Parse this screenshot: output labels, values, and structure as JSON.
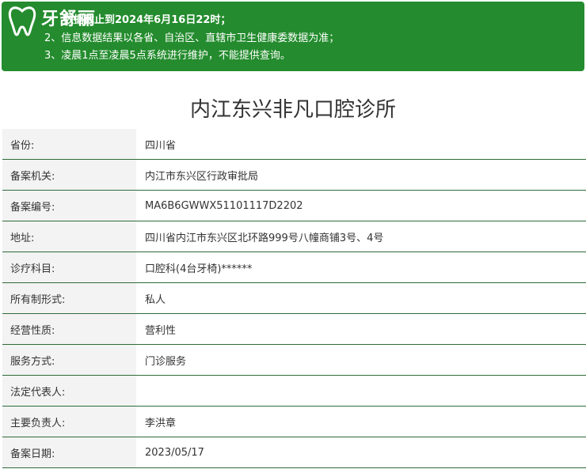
{
  "banner": {
    "brand": "牙舒丽",
    "notice_1": "数据截止到2024年6月16日22时；",
    "notice_2": "2、信息数据结果以各省、自治区、直辖市卫生健康委数据为准；",
    "notice_3": "3、凌晨1点至凌晨5点系统进行维护，不能提供查询。",
    "color": "#248c2e"
  },
  "page_title": "内江东兴非凡口腔诊所",
  "rows": [
    {
      "label": "省份:",
      "value": "四川省"
    },
    {
      "label": "备案机关:",
      "value": "内江市东兴区行政审批局"
    },
    {
      "label": "备案编号:",
      "value": "MA6B6GWWX51101117D2202"
    },
    {
      "label": "地址:",
      "value": "四川省内江市东兴区北环路999号八幢商铺3号、4号"
    },
    {
      "label": "诊疗科目:",
      "value": "口腔科(4台牙椅)******"
    },
    {
      "label": "所有制形式:",
      "value": "私人"
    },
    {
      "label": "经营性质:",
      "value": "营利性"
    },
    {
      "label": "服务方式:",
      "value": "门诊服务"
    },
    {
      "label": "法定代表人:",
      "value": ""
    },
    {
      "label": "主要负责人:",
      "value": "李洪章"
    },
    {
      "label": "备案日期:",
      "value": "2023/05/17"
    }
  ]
}
